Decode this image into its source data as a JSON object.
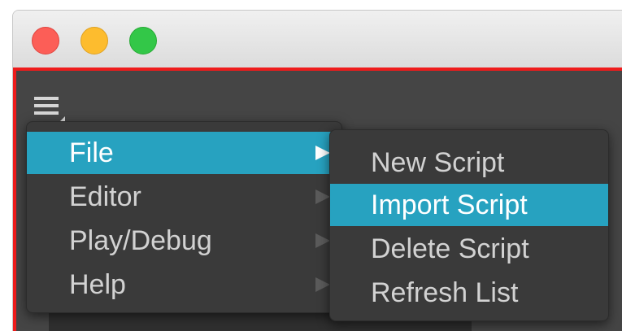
{
  "window": {
    "traffic_lights": [
      {
        "name": "close",
        "color": "#fc5e57"
      },
      {
        "name": "minimize",
        "color": "#fdbc2e"
      },
      {
        "name": "maximize",
        "color": "#33c748"
      }
    ]
  },
  "menu_button": {
    "icon": "hamburger-menu-icon"
  },
  "main_menu": {
    "items": [
      {
        "label": "File",
        "has_submenu": true,
        "active": true
      },
      {
        "label": "Editor",
        "has_submenu": true,
        "active": false
      },
      {
        "label": "Play/Debug",
        "has_submenu": true,
        "active": false
      },
      {
        "label": "Help",
        "has_submenu": true,
        "active": false
      }
    ]
  },
  "file_submenu": {
    "items": [
      {
        "label": "New Script",
        "active": false
      },
      {
        "label": "Import Script",
        "active": true
      },
      {
        "label": "Delete Script",
        "active": false
      },
      {
        "label": "Refresh List",
        "active": false
      }
    ]
  },
  "colors": {
    "highlight": "#27a2c0",
    "panel_border": "#ee1c1c",
    "menu_background": "#3a3a3a",
    "menu_text": "#d2d2d2"
  }
}
